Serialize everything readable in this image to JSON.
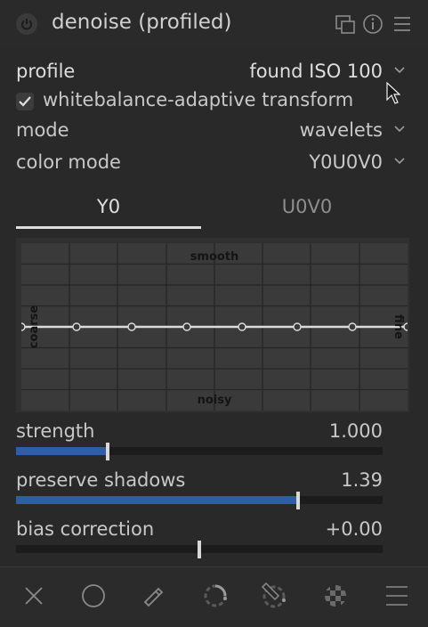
{
  "module": {
    "title": "denoise (profiled)"
  },
  "header_icons": [
    "power-icon",
    "multi-instance-icon",
    "reset-icon",
    "presets-icon"
  ],
  "settings": {
    "profile": {
      "label": "profile",
      "value": "found ISO 100"
    },
    "whitebalance": {
      "label": "whitebalance-adaptive transform",
      "checked": true
    },
    "mode": {
      "label": "mode",
      "value": "wavelets"
    },
    "color_mode": {
      "label": "color mode",
      "value": "Y0U0V0"
    }
  },
  "tabs": [
    {
      "label": "Y0",
      "active": true
    },
    {
      "label": "U0V0",
      "active": false
    }
  ],
  "graph": {
    "top_label": "smooth",
    "bottom_label": "noisy",
    "left_label": "coarse",
    "right_label": "fine",
    "node_levels": [
      0.5,
      0.5,
      0.5,
      0.5,
      0.5,
      0.5,
      0.5,
      0.5
    ]
  },
  "sliders": [
    {
      "label": "strength",
      "value": "1.000",
      "fraction": 0.25
    },
    {
      "label": "preserve shadows",
      "value": "1.39",
      "fraction": 0.77
    },
    {
      "label": "bias correction",
      "value": "+0.00",
      "fraction": 0.5
    }
  ],
  "footer_icons": [
    "close-icon",
    "circle-icon",
    "pencil-icon",
    "drawn-parametric-icon",
    "parametric-mask-icon",
    "raster-mask-icon",
    "menu-icon"
  ],
  "colors": {
    "accent": "#2f5da8",
    "background": "#242424",
    "panel": "#292929",
    "text": "#c8c8c8"
  }
}
